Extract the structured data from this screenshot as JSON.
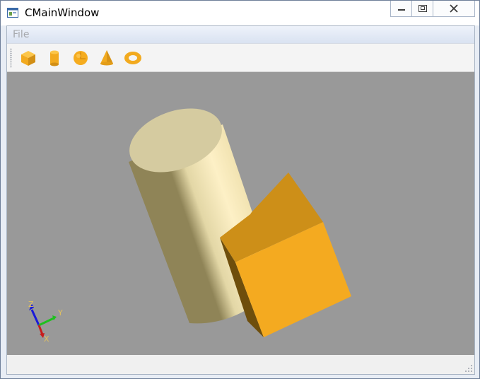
{
  "window": {
    "title": "CMainWindow",
    "caption_buttons": [
      "minimize",
      "maximize",
      "close"
    ]
  },
  "menubar": {
    "items": [
      {
        "label": "File"
      }
    ]
  },
  "toolbar": {
    "tools": [
      {
        "icon": "box-icon",
        "action": "box"
      },
      {
        "icon": "cylinder-icon",
        "action": "cylinder"
      },
      {
        "icon": "sphere-icon",
        "action": "sphere"
      },
      {
        "icon": "cone-icon",
        "action": "cone"
      },
      {
        "icon": "torus-icon",
        "action": "torus"
      }
    ]
  },
  "viewport": {
    "background": "#999999",
    "shapes": [
      {
        "type": "cylinder",
        "color": "#f5e9b8"
      },
      {
        "type": "box",
        "color": "#f2aa20"
      }
    ],
    "axis_triad": {
      "x_label": "X",
      "y_label": "Y",
      "z_label": "Z"
    }
  },
  "colors": {
    "accent": "#f4a81d",
    "cylinder": "#f5e9b8",
    "box_front": "#f2aa20",
    "box_top": "#cc8f17",
    "viewport_bg": "#999999"
  }
}
